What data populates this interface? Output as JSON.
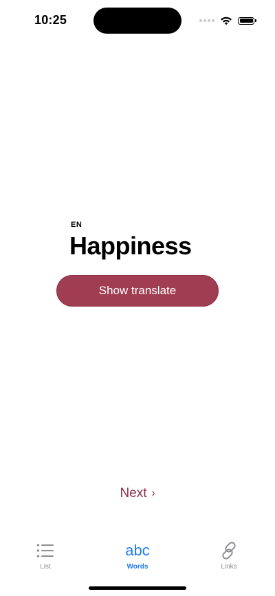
{
  "status_bar": {
    "time": "10:25"
  },
  "card": {
    "language": "EN",
    "word": "Happiness",
    "show_translate_label": "Show translate"
  },
  "next": {
    "label": "Next",
    "chevron": "›"
  },
  "tab_bar": {
    "tabs": [
      {
        "label": "List",
        "icon": "list-icon",
        "active": false
      },
      {
        "label": "Words",
        "icon": "abc",
        "active": true
      },
      {
        "label": "Links",
        "icon": "link-icon",
        "active": false
      }
    ]
  },
  "colors": {
    "accent_button": "#a13d52",
    "next_text": "#8b2e48",
    "tab_active": "#1f7cf0",
    "tab_inactive": "#8e8e93"
  }
}
